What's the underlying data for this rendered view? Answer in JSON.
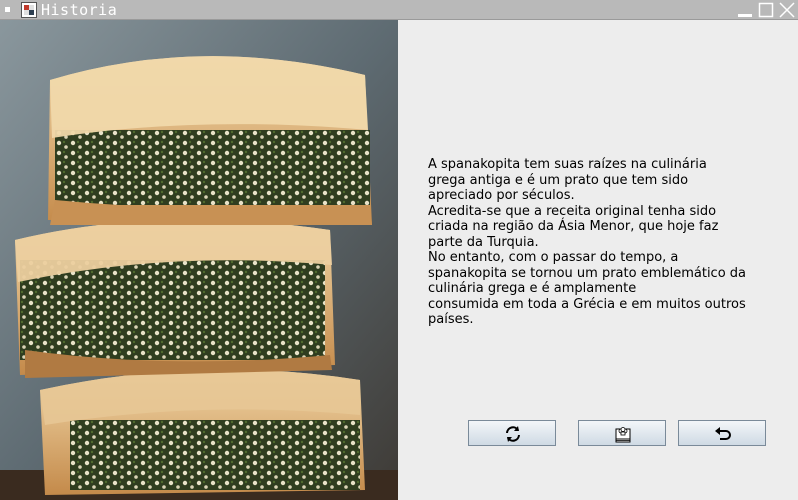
{
  "window": {
    "title": "Historia",
    "controls": [
      "minimize-icon",
      "maximize-icon",
      "close-icon"
    ]
  },
  "image": {
    "subject": "spanakopita",
    "alt": "Spanakopita"
  },
  "story": {
    "text": "A spanakopita tem suas raízes na culinária\ngrega antiga e é um prato que tem sido\napreciado por séculos.\nAcredita-se que a receita original tenha sido\ncriada na região da Ásia Menor, que hoje faz\nparte da Turquia.\nNo entanto, com o passar do tempo, a\nspanakopita se tornou um prato emblemático da\nculinária grega e é amplamente\nconsumida em toda a Grécia e em muitos outros\npaíses."
  },
  "buttons": {
    "refresh_icon": "refresh-icon",
    "recipe_icon": "chef-book-icon",
    "back_icon": "undo-arrow-icon"
  },
  "colors": {
    "titlebar": "#b9b9b9",
    "background": "#ededed",
    "button_border": "#7a8a99"
  }
}
